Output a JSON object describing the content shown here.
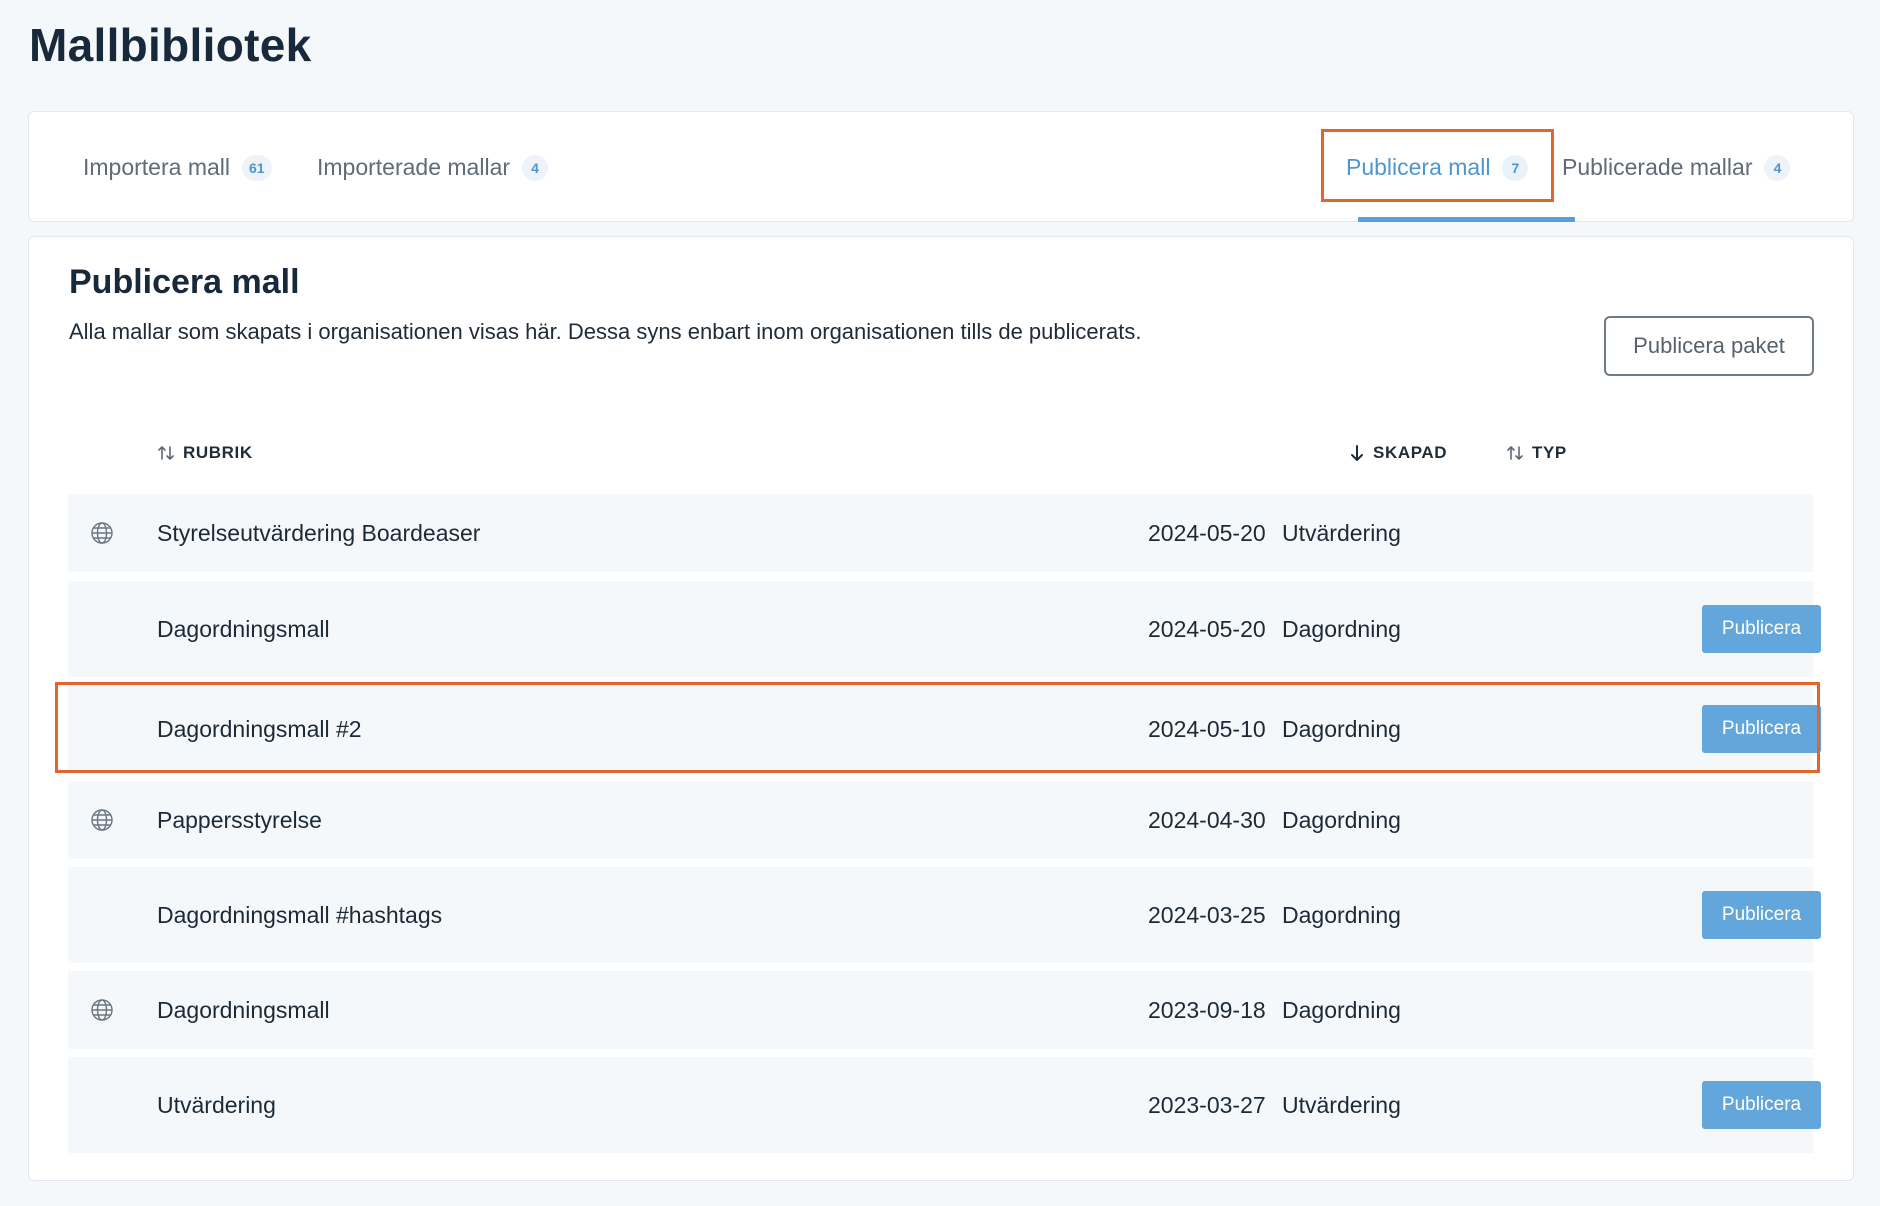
{
  "page": {
    "title": "Mallbibliotek"
  },
  "tabs": [
    {
      "label": "Importera mall",
      "count": "61"
    },
    {
      "label": "Importerade mallar",
      "count": "4"
    },
    {
      "label": "Publicera mall",
      "count": "7"
    },
    {
      "label": "Publicerade mallar",
      "count": "4"
    }
  ],
  "section": {
    "title": "Publicera mall",
    "description": "Alla mallar som skapats i organisationen visas här. Dessa syns enbart inom organisationen tills de publicerats.",
    "publish_package_label": "Publicera paket"
  },
  "table": {
    "headers": {
      "title": "RUBRIK",
      "created": "SKAPAD",
      "type": "TYP"
    },
    "rows": [
      {
        "title": "Styrelseutvärdering Boardeaser",
        "created": "2024-05-20",
        "type": "Utvärdering",
        "published": true
      },
      {
        "title": "Dagordningsmall",
        "created": "2024-05-20",
        "type": "Dagordning",
        "published": false,
        "action": "Publicera"
      },
      {
        "title": "Dagordningsmall #2",
        "created": "2024-05-10",
        "type": "Dagordning",
        "published": false,
        "action": "Publicera"
      },
      {
        "title": "Pappersstyrelse",
        "created": "2024-04-30",
        "type": "Dagordning",
        "published": true
      },
      {
        "title": "Dagordningsmall #hashtags",
        "created": "2024-03-25",
        "type": "Dagordning",
        "published": false,
        "action": "Publicera"
      },
      {
        "title": "Dagordningsmall",
        "created": "2023-09-18",
        "type": "Dagordning",
        "published": true
      },
      {
        "title": "Utvärdering",
        "created": "2023-03-27",
        "type": "Utvärdering",
        "published": false,
        "action": "Publicera"
      }
    ]
  },
  "icons": {
    "published": "globe-icon",
    "sort": "sort-arrows-icon",
    "sort_desc": "arrow-down-icon"
  },
  "colors": {
    "accent": "#4f96cf",
    "button": "#62a6dc",
    "highlight": "#e2652d"
  }
}
